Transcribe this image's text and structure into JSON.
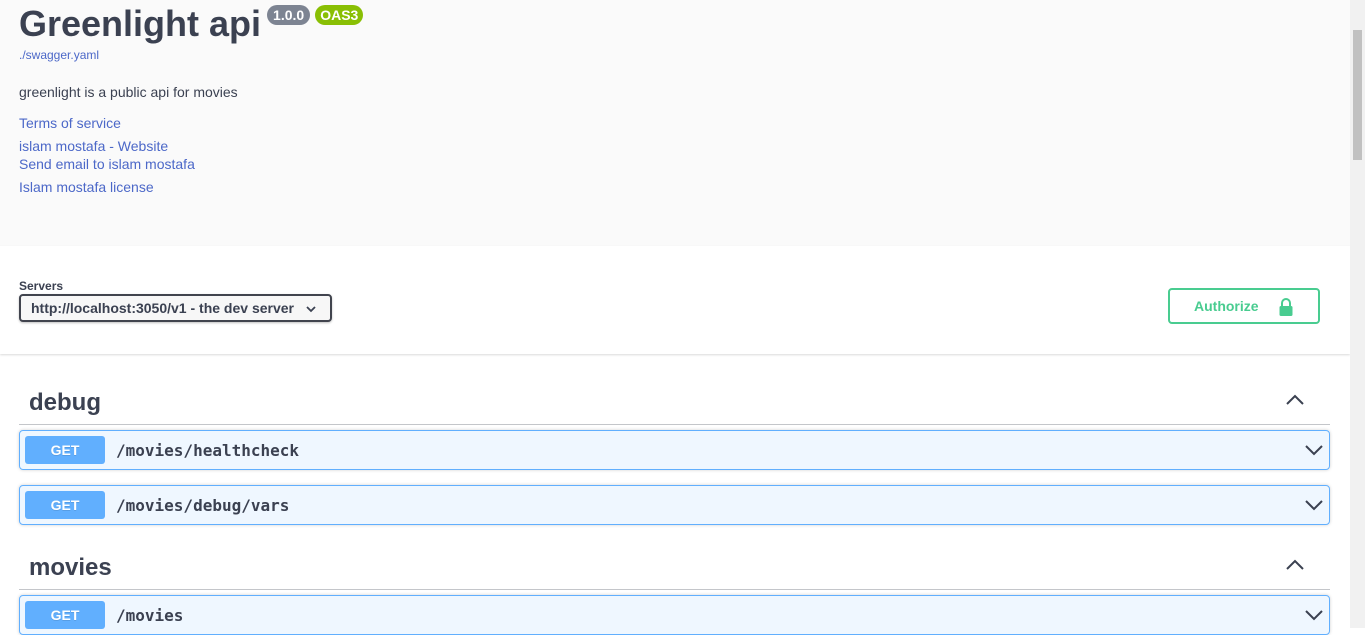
{
  "info": {
    "title": "Greenlight api",
    "version": "1.0.0",
    "oas_badge": "OAS3",
    "spec_link": "./swagger.yaml",
    "description": "greenlight is a public api for movies",
    "links": {
      "terms": "Terms of service",
      "website": "islam mostafa - Website",
      "email": "Send email to islam mostafa",
      "license": "Islam mostafa license"
    }
  },
  "servers": {
    "label": "Servers",
    "selected": "http://localhost:3050/v1 - the dev server"
  },
  "authorize": {
    "label": "Authorize"
  },
  "tags": [
    {
      "name": "debug",
      "operations": [
        {
          "method": "GET",
          "path": "/movies/healthcheck"
        },
        {
          "method": "GET",
          "path": "/movies/debug/vars"
        }
      ]
    },
    {
      "name": "movies",
      "operations": [
        {
          "method": "GET",
          "path": "/movies"
        }
      ]
    }
  ],
  "colors": {
    "get_method": "#61affe",
    "authorize": "#49cc90",
    "version_badge": "#7d8492",
    "oas_badge": "#89bf04",
    "link": "#4c68c8"
  }
}
